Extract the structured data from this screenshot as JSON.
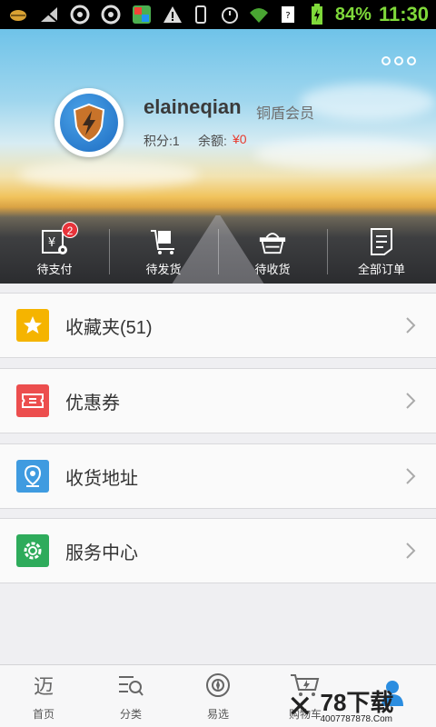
{
  "status_bar": {
    "battery_percent": "84%",
    "time": "11:30",
    "icons": [
      "android-icon",
      "signal-off-icon",
      "sync-icon",
      "sync-icon",
      "app-icon",
      "warning-icon",
      "vibrate-icon",
      "alarm-icon",
      "wifi-icon",
      "sim-icon",
      "battery-charging-icon"
    ]
  },
  "profile": {
    "username": "elaineqian",
    "member_level": "铜盾会员",
    "points": "积分:1",
    "balance_label": "余额:",
    "balance_value": "¥0",
    "avatar_icon": "shield-lightning-icon"
  },
  "orders": [
    {
      "label": "待支付",
      "icon": "payment-icon",
      "badge": "2"
    },
    {
      "label": "待发货",
      "icon": "cart-box-icon"
    },
    {
      "label": "待收货",
      "icon": "basket-icon"
    },
    {
      "label": "全部订单",
      "icon": "order-list-icon"
    }
  ],
  "menu": [
    {
      "label": "收藏夹(51)",
      "icon": "star-icon",
      "color": "#f5b400"
    },
    {
      "label": "优惠券",
      "icon": "coupon-icon",
      "color": "#ec4e4e"
    },
    {
      "label": "收货地址",
      "icon": "location-icon",
      "color": "#3f9be0"
    },
    {
      "label": "服务中心",
      "icon": "gear-icon",
      "color": "#2eab5b"
    }
  ],
  "tabs": [
    {
      "label": "首页",
      "icon": "home-icon"
    },
    {
      "label": "分类",
      "icon": "category-search-icon"
    },
    {
      "label": "易选",
      "icon": "compass-icon"
    },
    {
      "label": "购物车",
      "icon": "cart-icon"
    },
    {
      "label": "",
      "icon": "user-icon"
    }
  ],
  "watermark": {
    "big": "78下载",
    "small": "4007787878.Com"
  }
}
